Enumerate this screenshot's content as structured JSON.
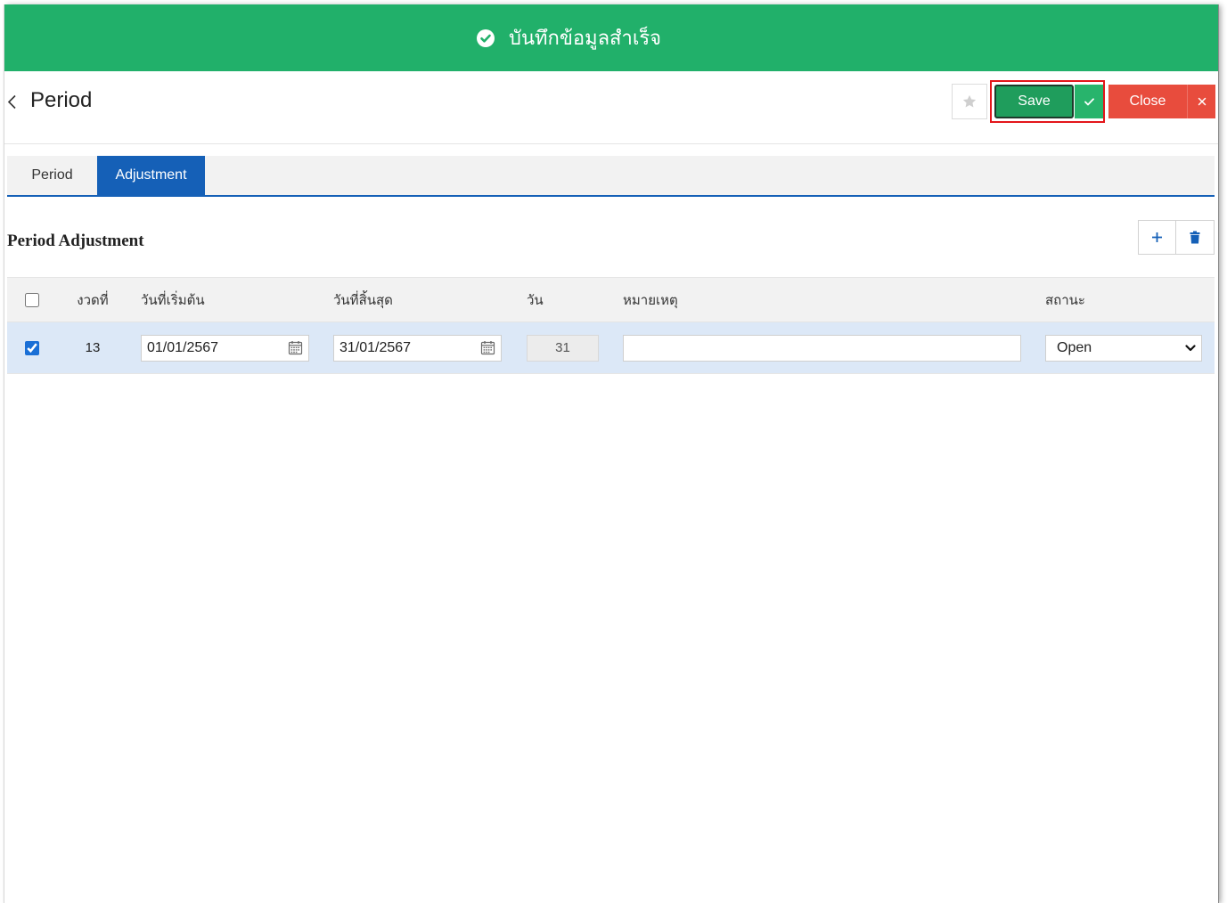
{
  "theme": {
    "success": "#21b06a",
    "save": "#1f9d5c",
    "save_confirm": "#28b46c",
    "danger": "#e84c3d",
    "primary": "#1560b7",
    "checkbox": "#1a6fd6",
    "highlight": "#e3161b",
    "row_selected": "#dce8f7"
  },
  "notification": {
    "icon": "check-circle-icon",
    "message": "บันทึกข้อมูลสำเร็จ"
  },
  "header": {
    "back_icon": "chevron-left-icon",
    "title": "Period",
    "favorite_icon": "star-icon",
    "save_label": "Save",
    "save_confirm_icon": "check-icon",
    "close_label": "Close",
    "close_icon": "close-icon"
  },
  "tabs": [
    {
      "label": "Period",
      "active": false
    },
    {
      "label": "Adjustment",
      "active": true
    }
  ],
  "section": {
    "title": "Period Adjustment",
    "add_icon": "plus-icon",
    "delete_icon": "trash-icon"
  },
  "table": {
    "header": {
      "select_all": false,
      "period_no": "งวดที่",
      "start_date": "วันที่เริ่มต้น",
      "end_date": "วันที่สิ้นสุด",
      "days": "วัน",
      "remark": "หมายเหตุ",
      "status": "สถานะ"
    },
    "rows": [
      {
        "selected": true,
        "period_no": "13",
        "start_date": "01/01/2567",
        "end_date": "31/01/2567",
        "calendar_icon": "calendar-icon",
        "days": "31",
        "remark": "",
        "status": "Open",
        "status_icon": "chevron-down-icon"
      }
    ]
  }
}
